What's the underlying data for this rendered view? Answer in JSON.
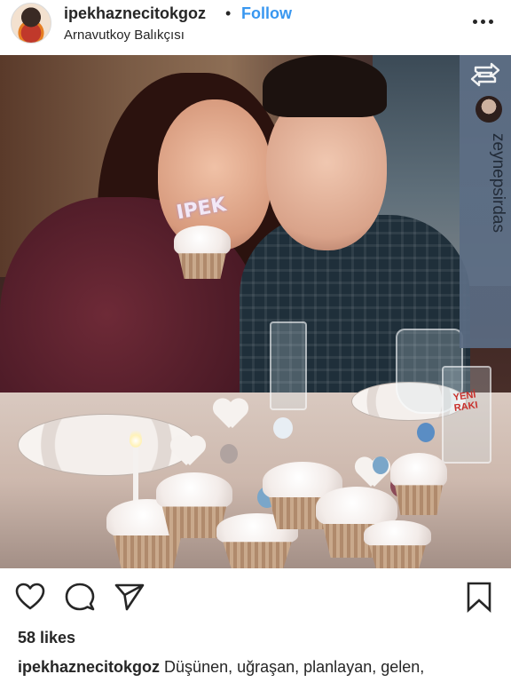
{
  "header": {
    "username": "ipekhaznecitokgoz",
    "separator": "•",
    "follow_label": "Follow",
    "location": "Arnavutkoy Balıkçısı"
  },
  "photo": {
    "topper_text": "IPEK",
    "bottle_label": "YENİ RAKI",
    "repost": {
      "icon": "repost-icon",
      "username": "zeynepsirdas"
    }
  },
  "actions": {
    "like_icon": "heart-icon",
    "comment_icon": "comment-icon",
    "share_icon": "share-icon",
    "save_icon": "bookmark-icon"
  },
  "likes": {
    "text": "58 likes"
  },
  "caption": {
    "username": "ipekhaznecitokgoz",
    "text": "Düşünen, uğraşan, planlayan, gelen,"
  },
  "colors": {
    "follow": "#3897f0",
    "text": "#262626",
    "repost_band": "#5e6f86"
  }
}
